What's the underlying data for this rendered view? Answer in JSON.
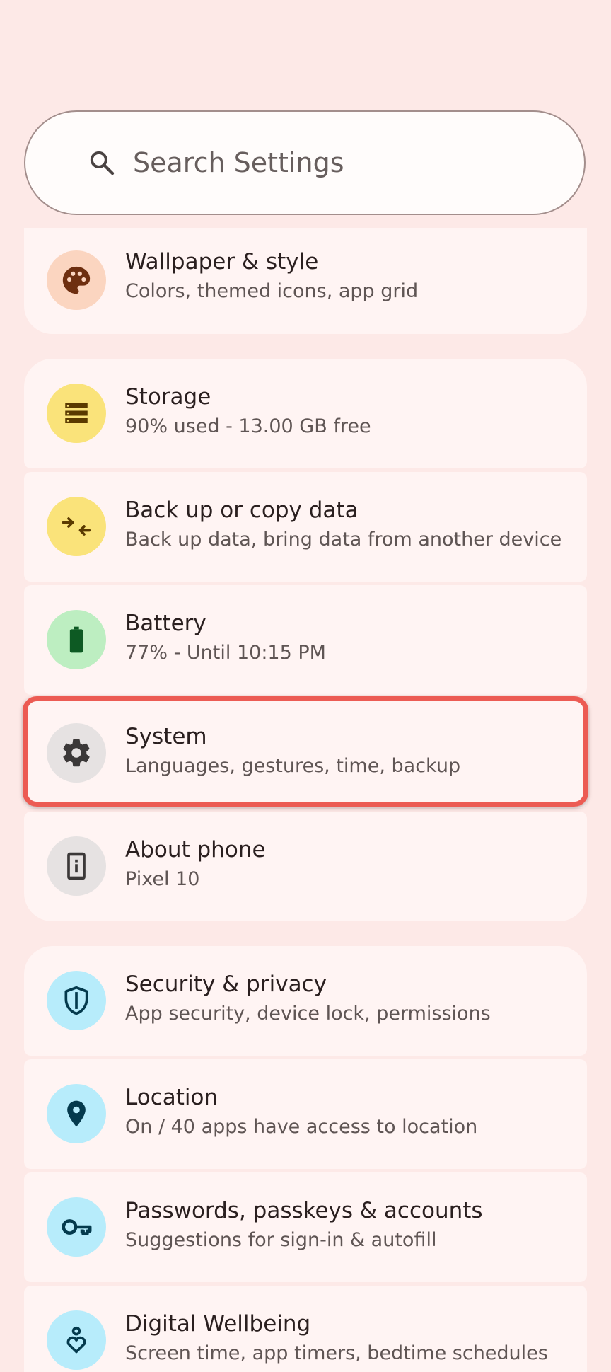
{
  "search": {
    "placeholder": "Search Settings",
    "icon": "search-icon"
  },
  "items": [
    {
      "title": "Wallpaper & style",
      "subtitle": "Colors, themed icons, app grid",
      "icon": "palette-icon",
      "icon_bg": "#fbd5c0",
      "icon_color": "#6e2f10"
    },
    {
      "title": "Storage",
      "subtitle": "90% used - 13.00 GB free",
      "icon": "storage-icon",
      "icon_bg": "#fae37a",
      "icon_color": "#5a3a00"
    },
    {
      "title": "Back up or copy data",
      "subtitle": "Back up data, bring data from another device",
      "icon": "backup-arrows-icon",
      "icon_bg": "#fae37a",
      "icon_color": "#5a3a00"
    },
    {
      "title": "Battery",
      "subtitle": "77% - Until 10:15 PM",
      "icon": "battery-icon",
      "icon_bg": "#bdeec1",
      "icon_color": "#0d5a23"
    },
    {
      "title": "System",
      "subtitle": "Languages, gestures, time, backup",
      "icon": "gear-icon",
      "icon_bg": "#e6e2e2",
      "icon_color": "#3b3838"
    },
    {
      "title": "About phone",
      "subtitle": "Pixel 10",
      "icon": "phone-info-icon",
      "icon_bg": "#e6e2e2",
      "icon_color": "#3b3838"
    },
    {
      "title": "Security & privacy",
      "subtitle": "App security, device lock, permissions",
      "icon": "shield-icon",
      "icon_bg": "#b7ecfb",
      "icon_color": "#043a4d"
    },
    {
      "title": "Location",
      "subtitle": "On / 40 apps have access to location",
      "icon": "location-pin-icon",
      "icon_bg": "#b7ecfb",
      "icon_color": "#043a4d"
    },
    {
      "title": "Passwords, passkeys & accounts",
      "subtitle": "Suggestions for sign-in & autofill",
      "icon": "key-icon",
      "icon_bg": "#b7ecfb",
      "icon_color": "#043a4d"
    },
    {
      "title": "Digital Wellbeing",
      "subtitle": "Screen time, app timers, bedtime schedules",
      "icon": "wellbeing-icon",
      "icon_bg": "#b7ecfb",
      "icon_color": "#043a4d"
    }
  ],
  "colors": {
    "background": "#fde9e7",
    "card": "#fff4f3",
    "highlight": "#ec5b53"
  }
}
